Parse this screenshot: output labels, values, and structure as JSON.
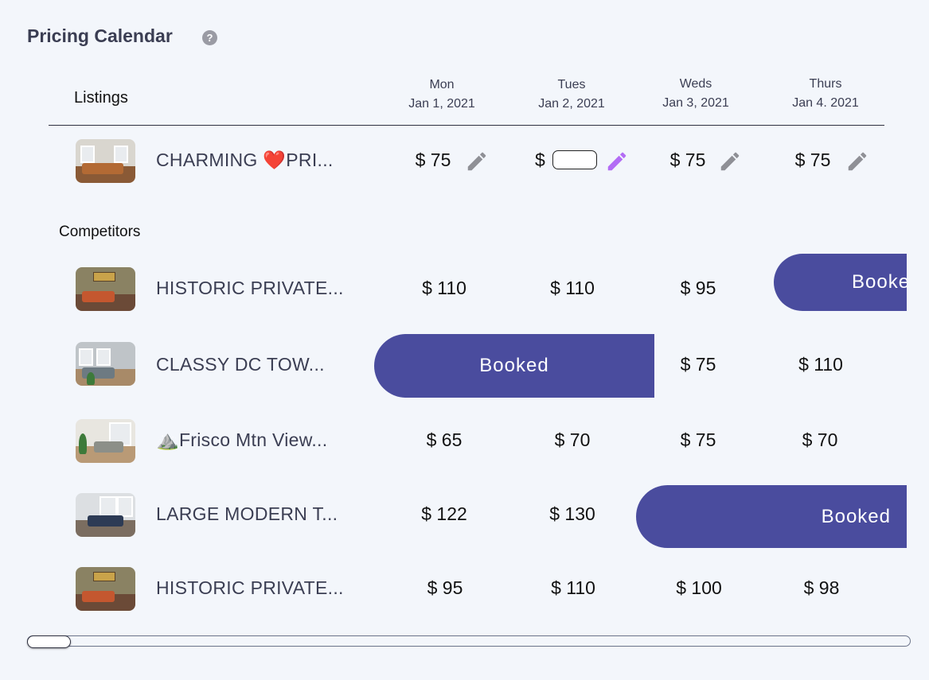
{
  "header": {
    "title": "Pricing Calendar",
    "help_icon": "question-circle-icon"
  },
  "table": {
    "listings_label": "Listings",
    "competitors_label": "Competitors",
    "days": [
      {
        "weekday": "Mon",
        "date": "Jan 1, 2021"
      },
      {
        "weekday": "Tues",
        "date": "Jan 2, 2021"
      },
      {
        "weekday": "Weds",
        "date": "Jan 3, 2021"
      },
      {
        "weekday": "Thurs",
        "date": "Jan 4. 2021"
      }
    ]
  },
  "listing": {
    "name_prefix": "CHARMING ",
    "name_emoji": "❤️",
    "name_suffix": "PRI...",
    "prices": [
      "$ 75",
      "$",
      "$ 75",
      "$ 75"
    ],
    "editing_value": "",
    "edit_icon": "pencil-icon",
    "active_edit_color": "#b36cf5",
    "inactive_edit_color": "#8f9096"
  },
  "competitors": [
    {
      "name": "HISTORIC PRIVATE...",
      "prices": [
        "$ 110",
        "$ 110",
        "$ 95"
      ],
      "booked_label": "Booked"
    },
    {
      "name": "CLASSY DC TOW...",
      "prices": [
        "$ 75",
        "$ 110"
      ],
      "booked_label": "Booked"
    },
    {
      "name_emoji": "⛰️",
      "name": "Frisco Mtn View...",
      "prices": [
        "$ 65",
        "$ 70",
        "$ 75",
        "$ 70"
      ]
    },
    {
      "name": "LARGE MODERN T...",
      "prices": [
        "$ 122",
        "$ 130"
      ],
      "booked_label": "Booked"
    },
    {
      "name": "HISTORIC PRIVATE...",
      "prices": [
        "$ 95",
        "$ 110",
        "$ 100",
        "$ 98"
      ]
    }
  ],
  "colors": {
    "booked": "#4a4c9e",
    "background": "#f3f6fb",
    "title": "#3b3e53"
  }
}
